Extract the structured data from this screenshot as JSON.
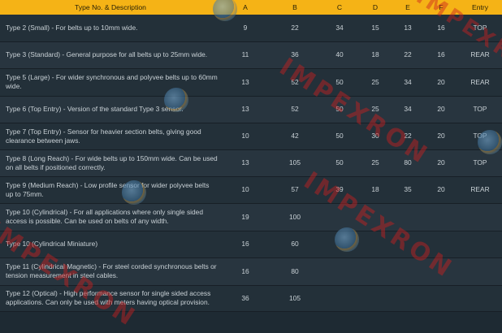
{
  "table": {
    "headers": [
      "Type No. & Description",
      "A",
      "B",
      "C",
      "D",
      "E",
      "F",
      "Entry"
    ],
    "rows": [
      [
        "Type 2 (Small) - For belts up to 10mm wide.",
        "9",
        "22",
        "34",
        "15",
        "13",
        "16",
        "TOP"
      ],
      [
        "Type 3 (Standard) - General purpose for all belts up to 25mm wide.",
        "11",
        "36",
        "40",
        "18",
        "22",
        "16",
        "REAR"
      ],
      [
        "Type 5 (Large) - For wider synchronous and polyvee belts up to 60mm wide.",
        "13",
        "52",
        "50",
        "25",
        "34",
        "20",
        "REAR"
      ],
      [
        "Type 6 (Top Entry) - Version of the standard Type 3 sensor.",
        "13",
        "52",
        "50",
        "25",
        "34",
        "20",
        "TOP"
      ],
      [
        "Type 7 (Top Entry) - Sensor for heavier section belts, giving good clearance between jaws.",
        "10",
        "42",
        "50",
        "30",
        "22",
        "20",
        "TOP"
      ],
      [
        "Type 8 (Long Reach) - For wide belts up to 150mm wide. Can be used on all belts if positioned correctly.",
        "13",
        "105",
        "50",
        "25",
        "80",
        "20",
        "TOP"
      ],
      [
        "Type 9 (Medium Reach) - Low profile sensor for wider polyvee belts up to 75mm.",
        "10",
        "57",
        "39",
        "18",
        "35",
        "20",
        "REAR"
      ],
      [
        "Type 10 (Cylindrical) - For all applications where only single sided access is possible. Can be used on belts of any width.",
        "19",
        "100",
        "",
        "",
        "",
        "",
        ""
      ],
      [
        "Type 10 (Cylindrical Miniature)",
        "16",
        "60",
        "",
        "",
        "",
        "",
        ""
      ],
      [
        "Type 11 (Cylindrical Magnetic) - For steel corded synchronous belts or tension measurement in steel cables.",
        "16",
        "80",
        "",
        "",
        "",
        "",
        ""
      ],
      [
        "Type 12 (Optical) - High performance sensor for single sided access applications. Can only be used with meters having optical provision.",
        "36",
        "105",
        "",
        "",
        "",
        "",
        ""
      ]
    ]
  },
  "watermark": "IMPEXRON"
}
